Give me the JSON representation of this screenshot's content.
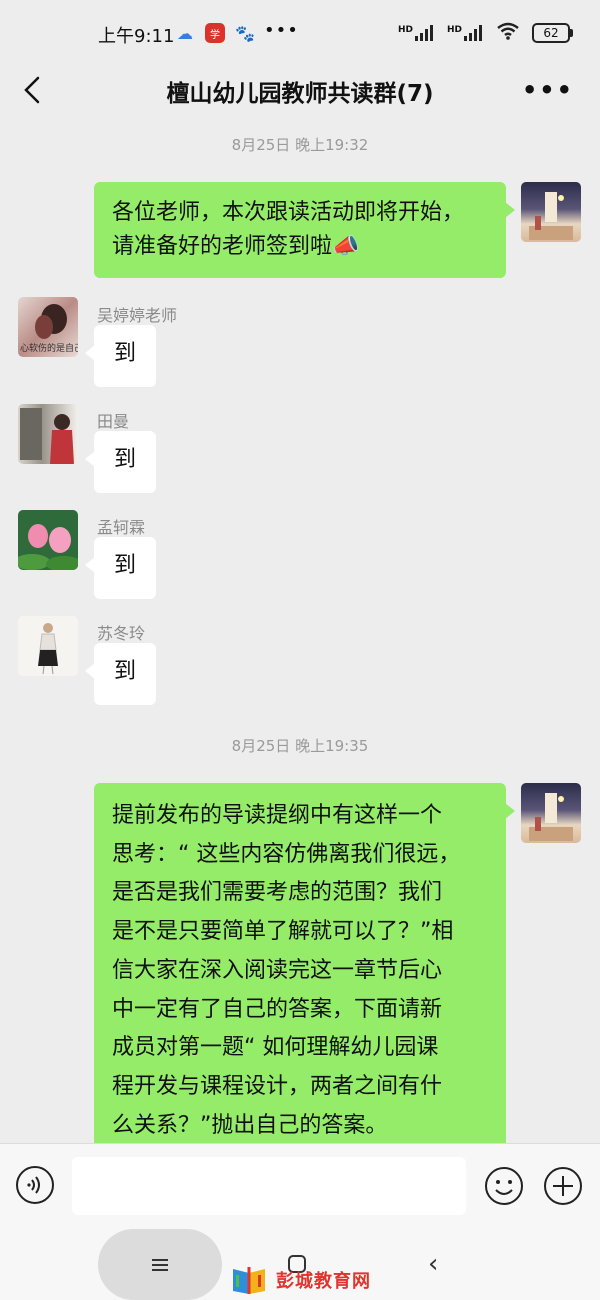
{
  "status_bar": {
    "time": "上午9:11",
    "signal_1": "HD",
    "signal_2": "HD",
    "battery": "62"
  },
  "header": {
    "title": "檀山幼儿园教师共读群(7)"
  },
  "messages": [
    {
      "type": "time",
      "text": "8月25日 晚上19:32"
    },
    {
      "type": "outgoing",
      "lines": [
        "各位老师，本次跟读活动即将开始，",
        "请准备好的老师签到啦📣"
      ]
    },
    {
      "type": "incoming",
      "sender": "吴婷婷老师",
      "text": "到",
      "avatar_caption": "心软伤的是自己"
    },
    {
      "type": "incoming",
      "sender": "田曼",
      "text": "到"
    },
    {
      "type": "incoming",
      "sender": "孟轲霖",
      "text": "到"
    },
    {
      "type": "incoming",
      "sender": "苏冬玲",
      "text": "到"
    },
    {
      "type": "time",
      "text": "8月25日 晚上19:35"
    },
    {
      "type": "outgoing",
      "lines": [
        "提前发布的导读提纲中有这样一个",
        "思考：“ 这些内容仿佛离我们很远，",
        "是否是我们需要考虑的范围？我们",
        "是不是只要简单了解就可以了？”相",
        "信大家在深入阅读完这一章节后心",
        "中一定有了自己的答案，下面请新",
        "成员对第一题“ 如何理解幼儿园课",
        "程开发与课程设计，两者之间有什",
        "么关系？”抛出自己的答案。"
      ]
    }
  ],
  "watermark": {
    "text": "彭城教育网"
  },
  "colors": {
    "background": "#ededed",
    "outgoing_bubble": "#95ec69",
    "incoming_bubble": "#ffffff",
    "watermark_red": "#e0342c"
  }
}
